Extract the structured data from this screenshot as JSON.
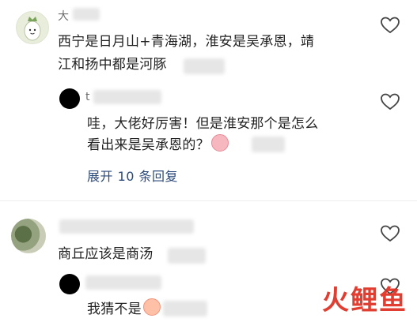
{
  "comments": [
    {
      "username": "大",
      "text_line1": "西宁是日月山+青海湖，淮安是吴承恩，靖",
      "text_line2": "江和扬中都是河豚",
      "reply": {
        "username": "t",
        "text_line1": "哇，大佬好厉害！但是淮安那个是怎么",
        "text_line2": "看出来是吴承恩的？",
        "emoji": "crying-face-emoji"
      },
      "expand_label": "展开 10 条回复"
    },
    {
      "username": "",
      "text": "商丘应该是商汤",
      "reply": {
        "username": "",
        "text": "我猜不是",
        "emoji": "peach-emoji"
      }
    }
  ],
  "watermark": "火鲤鱼",
  "colors": {
    "expand_link": "#2c4a7a",
    "watermark": "#e02d20"
  }
}
